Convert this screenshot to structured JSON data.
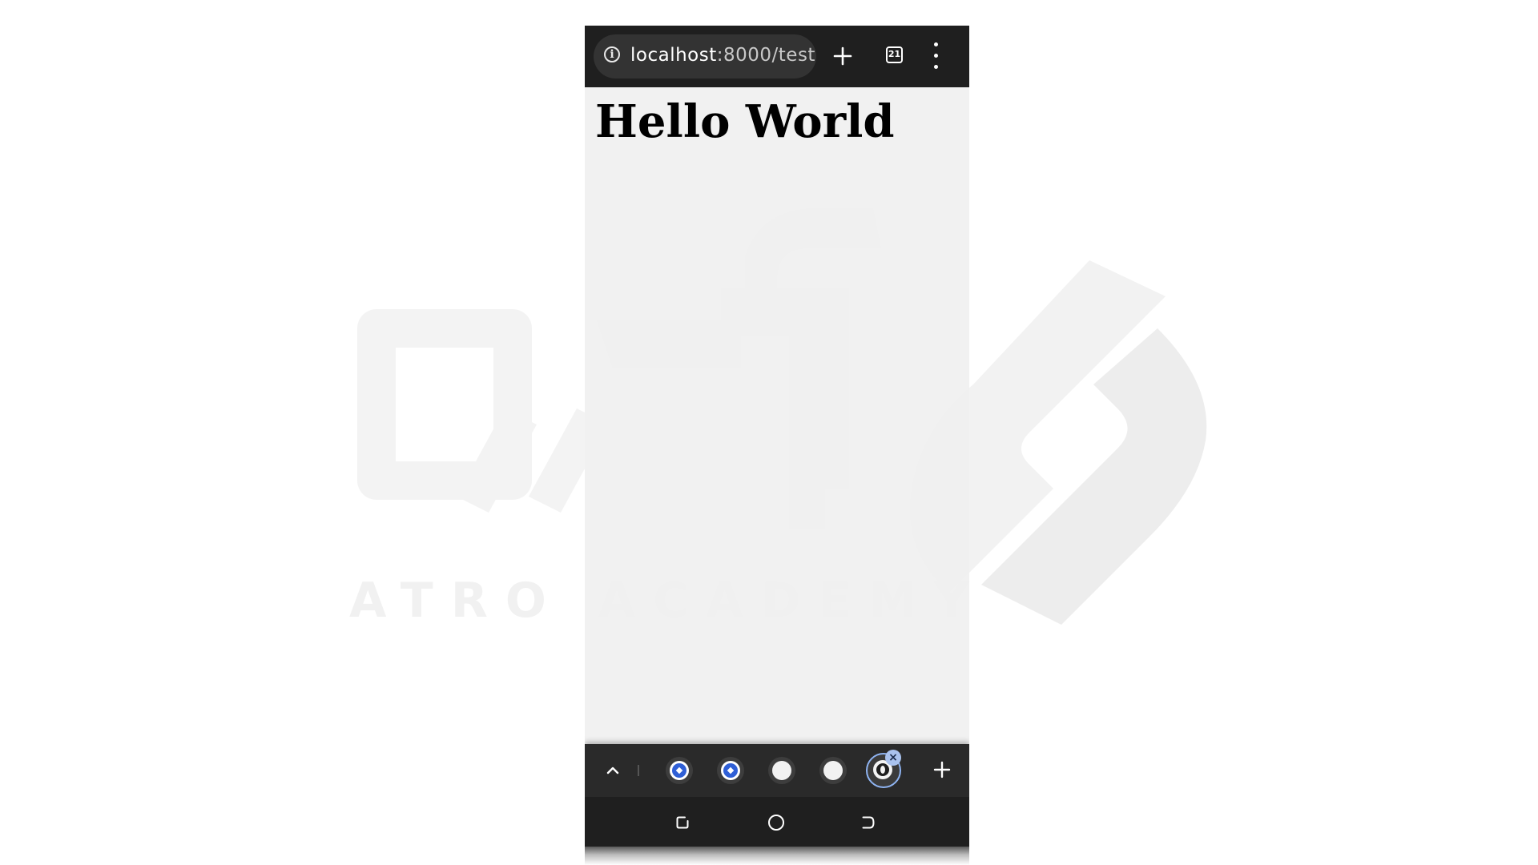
{
  "watermark": {
    "brand_text": "ATRO ACADEMY"
  },
  "browser": {
    "url_host": "localhost",
    "url_rest": ":8000/test",
    "new_tab_symbol": "+",
    "tab_count": "21",
    "icons": {
      "site_info": "info-icon",
      "new_tab": "plus-icon",
      "tab_switcher": "tab-switcher-icon",
      "menu": "more-vert-icon"
    }
  },
  "page": {
    "heading": "Hello World"
  },
  "tab_strip": {
    "collapse_icon": "chevron-up-icon",
    "tabs": [
      {
        "icon": "blue-diamond-favicon",
        "active": false
      },
      {
        "icon": "blue-diamond-favicon",
        "active": false
      },
      {
        "icon": "blank-favicon",
        "active": false
      },
      {
        "icon": "blank-favicon",
        "active": false
      },
      {
        "icon": "globe-favicon",
        "active": true
      }
    ],
    "close_symbol": "×",
    "add_symbol": "+"
  },
  "system_nav": {
    "recent_icon": "recent-apps-icon",
    "home_icon": "home-icon",
    "back_icon": "back-icon"
  },
  "colors": {
    "chrome_dark": "#1f1f1f",
    "page_bg": "#f0f0f0",
    "accent_blue": "#2f5fd6",
    "active_ring": "#8fb4f2"
  }
}
